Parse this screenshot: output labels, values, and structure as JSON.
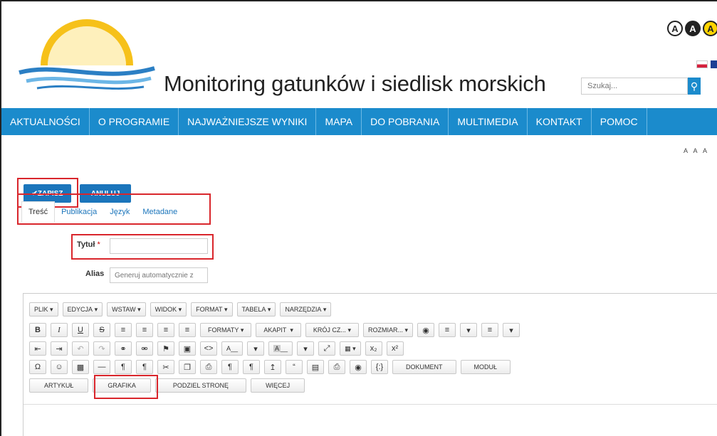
{
  "header": {
    "site_title": "Monitoring gatunków i siedlisk morskich",
    "contrast": [
      "A",
      "A",
      "A"
    ],
    "search_placeholder": "Szukaj...",
    "search_icon": "search-icon",
    "font_size_controls": "A A A"
  },
  "nav": {
    "items": [
      "AKTUALNOŚCI",
      "O PROGRAMIE",
      "NAJWAŻNIEJSZE WYNIKI",
      "MAPA",
      "DO POBRANIA",
      "MULTIMEDIA",
      "KONTAKT",
      "POMOC"
    ]
  },
  "actions": {
    "save": "ZAPISZ",
    "cancel": "ANULUJ"
  },
  "tabs": [
    "Treść",
    "Publikacja",
    "Język",
    "Metadane"
  ],
  "form": {
    "title_label": "Tytuł",
    "title_required": "*",
    "title_value": "",
    "alias_label": "Alias",
    "alias_placeholder": "Generuj automatycznie z"
  },
  "editor": {
    "menu": [
      "PLIK",
      "EDYCJA",
      "WSTAW",
      "WIDOK",
      "FORMAT",
      "TABELA",
      "NARZĘDZIA"
    ],
    "row2": {
      "bold": "B",
      "italic": "I",
      "underline": "U",
      "strike": "S",
      "formaty": "FORMATY",
      "akapit": "AKAPIT",
      "font": "KRÓJ CZ...",
      "size": "ROZMIAR..."
    },
    "row3": {
      "text_color": "A",
      "bg_color": "A",
      "sub": "x₂",
      "sup": "x²"
    },
    "row4": {
      "omega": "Ω",
      "dokument": "DOKUMENT",
      "modul": "MODUŁ",
      "code": "{:}"
    },
    "row5": [
      "ARTYKUŁ",
      "GRAFIKA",
      "PODZIEL STRONĘ",
      "WIĘCEJ"
    ]
  },
  "colors": {
    "brand_blue": "#1b8bcc",
    "button_blue": "#1b75bb",
    "highlight_red": "#d9262c"
  }
}
